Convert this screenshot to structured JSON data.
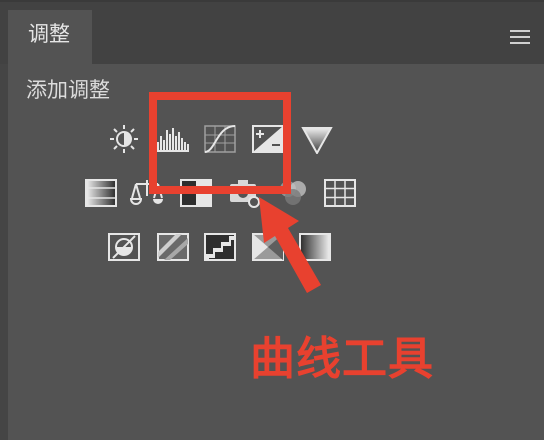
{
  "panel": {
    "tab_label": "调整",
    "section_title": "添加调整"
  },
  "icons": {
    "row1": [
      "brightness-contrast-icon",
      "levels-icon",
      "curves-icon",
      "exposure-icon",
      "vibrance-icon"
    ],
    "row2": [
      "hue-saturation-icon",
      "color-balance-icon",
      "black-white-icon",
      "photo-filter-icon",
      "channel-mixer-icon",
      "color-lookup-icon"
    ],
    "row3": [
      "invert-icon",
      "posterize-icon",
      "threshold-icon",
      "selective-color-icon",
      "gradient-map-icon"
    ]
  },
  "annotation": {
    "text": "曲线工具",
    "color": "#e8412f"
  },
  "colors": {
    "panel_bg": "#535353",
    "tabbar_bg": "#424242",
    "accent": "#e8412f"
  }
}
